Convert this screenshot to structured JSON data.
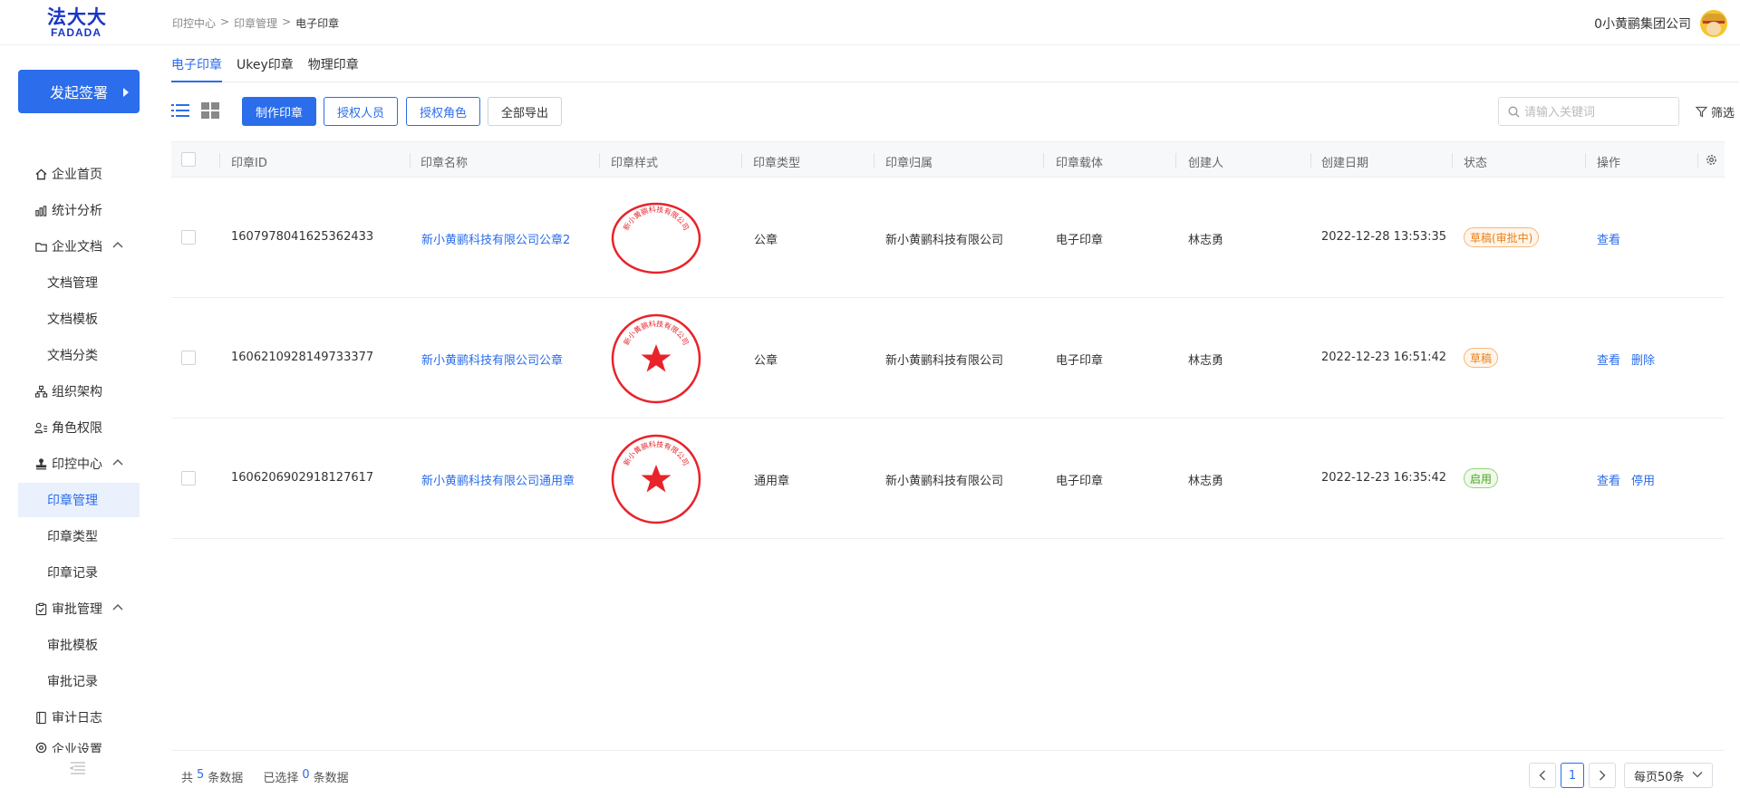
{
  "header": {
    "logo_cn": "法大大",
    "logo_en": "FADADA",
    "breadcrumb": [
      "印控中心",
      "印章管理",
      "电子印章"
    ],
    "breadcrumb_sep": ">",
    "company": "0小黄鹂集团公司"
  },
  "sidebar": {
    "start_button": "发起签署",
    "items": [
      {
        "label": "企业首页",
        "icon": "home-icon"
      },
      {
        "label": "统计分析",
        "icon": "chart-icon"
      },
      {
        "label": "企业文档",
        "icon": "folder-icon"
      },
      {
        "label": "文档管理"
      },
      {
        "label": "文档模板"
      },
      {
        "label": "文档分类"
      },
      {
        "label": "组织架构",
        "icon": "org-icon"
      },
      {
        "label": "角色权限",
        "icon": "role-icon"
      },
      {
        "label": "印控中心",
        "icon": "stamp-icon"
      },
      {
        "label": "印章管理"
      },
      {
        "label": "印章类型"
      },
      {
        "label": "印章记录"
      },
      {
        "label": "审批管理",
        "icon": "approval-icon"
      },
      {
        "label": "审批模板"
      },
      {
        "label": "审批记录"
      },
      {
        "label": "审计日志",
        "icon": "log-icon"
      },
      {
        "label": "企业设置",
        "icon": "settings-icon"
      }
    ]
  },
  "tabs": [
    "电子印章",
    "Ukey印章",
    "物理印章"
  ],
  "toolbar": {
    "make_seal": "制作印章",
    "authorize_person": "授权人员",
    "authorize_role": "授权角色",
    "export_all": "全部导出",
    "search_placeholder": "请输入关键词",
    "filter": "筛选"
  },
  "table": {
    "columns": [
      "印章ID",
      "印章名称",
      "印章样式",
      "印章类型",
      "印章归属",
      "印章载体",
      "创建人",
      "创建日期",
      "状态",
      "操作"
    ],
    "rows": [
      {
        "id": "1607978041625362433",
        "name": "新小黄鹂科技有限公司公章2",
        "seal_text": "新小黄鹂科技有限公司",
        "type": "公章",
        "owner": "新小黄鹂科技有限公司",
        "carrier": "电子印章",
        "creator": "林志勇",
        "date": "2022-12-28 13:53:35",
        "status": "草稿(审批中)",
        "actions": [
          "查看"
        ]
      },
      {
        "id": "1606210928149733377",
        "name": "新小黄鹂科技有限公司公章",
        "seal_text": "新小黄鹂科技有限公司",
        "type": "公章",
        "owner": "新小黄鹂科技有限公司",
        "carrier": "电子印章",
        "creator": "林志勇",
        "date": "2022-12-23 16:51:42",
        "status": "草稿",
        "actions": [
          "查看",
          "删除"
        ]
      },
      {
        "id": "1606206902918127617",
        "name": "新小黄鹂科技有限公司通用章",
        "seal_text": "新小黄鹂科技有限公司",
        "type": "通用章",
        "owner": "新小黄鹂科技有限公司",
        "carrier": "电子印章",
        "creator": "林志勇",
        "date": "2022-12-23 16:35:42",
        "status": "启用",
        "actions": [
          "查看",
          "停用"
        ]
      }
    ]
  },
  "footer": {
    "total_prefix": "共",
    "total": "5",
    "total_suffix": "条数据",
    "selected_prefix": "已选择",
    "selected": "0",
    "selected_suffix": "条数据",
    "page": "1",
    "page_size": "每页50条"
  },
  "colors": {
    "accent": "#2b6dea",
    "seal": "#e8232a",
    "draft": "#e8801a",
    "enabled": "#4aa51f"
  }
}
